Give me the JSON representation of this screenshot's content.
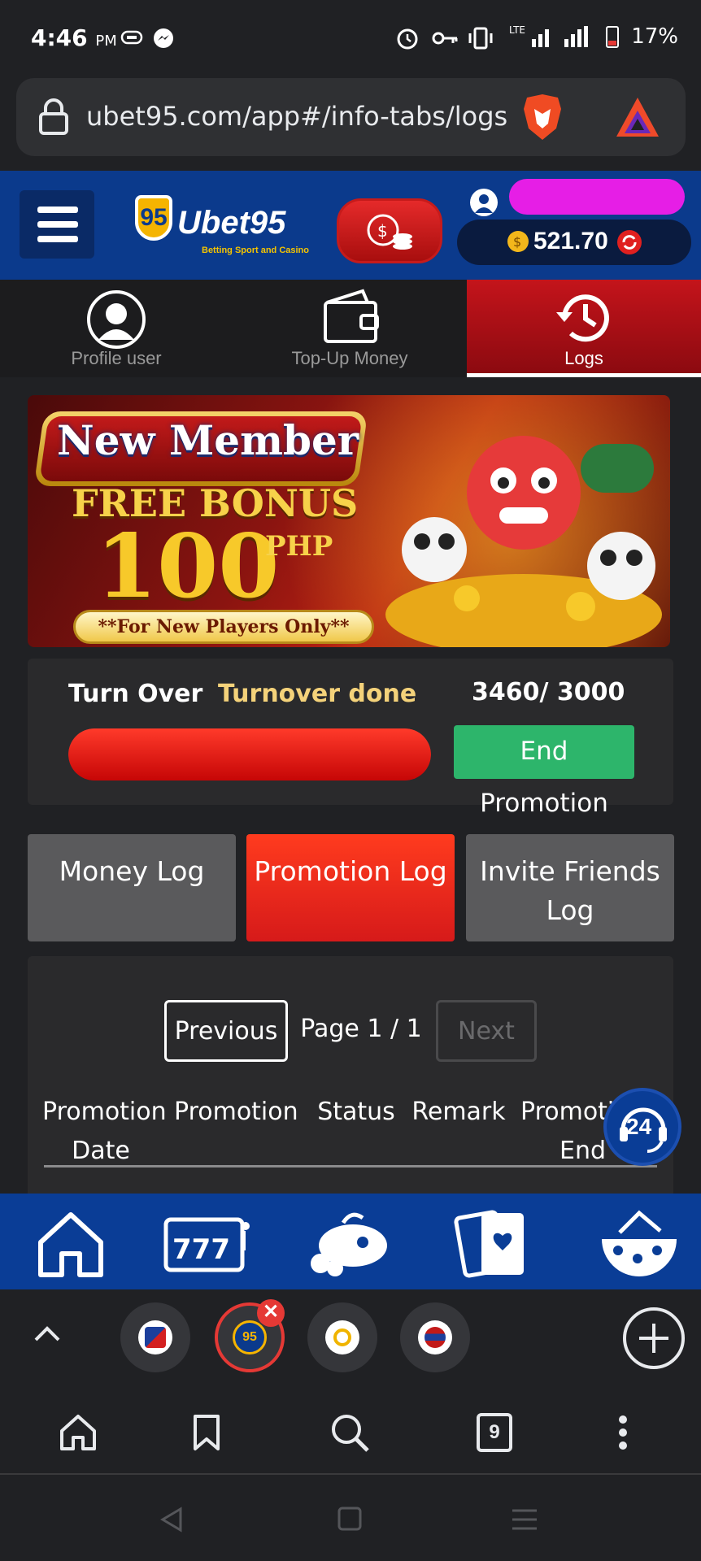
{
  "status_bar": {
    "time": "4:46",
    "ampm": "PM",
    "network": "LTE",
    "battery": "17%"
  },
  "browser": {
    "url": "ubet95.com/app#/info-tabs/logs"
  },
  "site": {
    "logo_text": "Ubet95",
    "logo_badge": "95",
    "logo_tagline": "Betting Sport and Casino",
    "balance": "521.70"
  },
  "nav_tabs": [
    {
      "label": "Profile user"
    },
    {
      "label": "Top-Up Money"
    },
    {
      "label": "Logs"
    }
  ],
  "banner": {
    "headline": "New Member",
    "line2": "FREE BONUS",
    "amount": "100",
    "currency": "PHP",
    "footnote": "**For New Players Only**"
  },
  "turnover": {
    "label": "Turn Over",
    "status": "Turnover done",
    "progress_text": "3460/ 3000",
    "progress": 1.0,
    "end_button": "End Promotion"
  },
  "log_tabs": [
    {
      "label": "Money Log",
      "active": false
    },
    {
      "label": "Promotion Log",
      "active": true
    },
    {
      "label": "Invite Friends Log",
      "active": false
    }
  ],
  "pagination": {
    "previous": "Previous",
    "page_text": "Page 1 / 1",
    "next": "Next"
  },
  "table_headers": [
    {
      "line1": "Promotion",
      "line2": ""
    },
    {
      "line1": "Promotion",
      "line2": "Date"
    },
    {
      "line1": "Status",
      "line2": ""
    },
    {
      "line1": "Remark",
      "line2": ""
    },
    {
      "line1": "Promoti",
      "line2": "End"
    }
  ],
  "support_badge": "24",
  "game_nav": [
    "home-icon",
    "slots-icon",
    "fishing-icon",
    "cards-icon",
    "lottery-icon"
  ],
  "tab_count": "9",
  "colors": {
    "brand_blue": "#0b3a8c",
    "active_red": "#d61a1a",
    "end_green": "#2db56b"
  }
}
